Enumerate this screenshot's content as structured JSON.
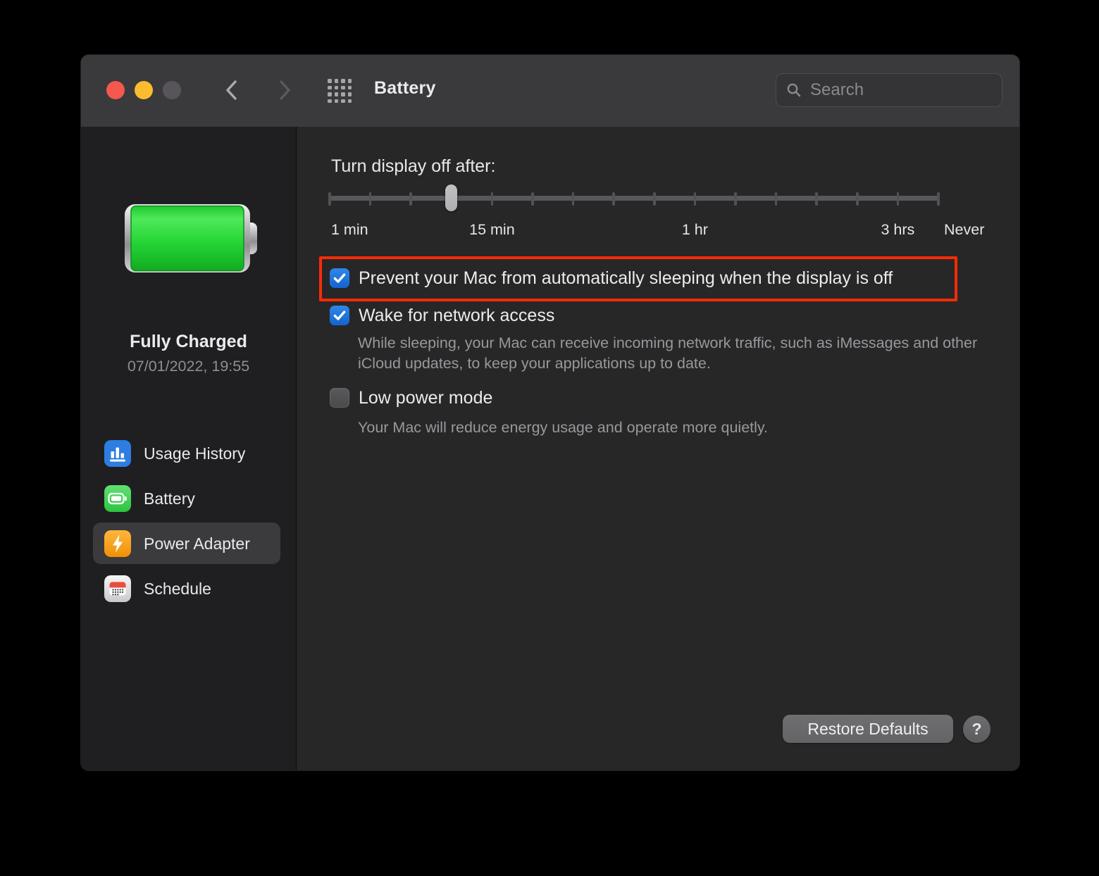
{
  "window": {
    "title": "Battery",
    "search_placeholder": "Search"
  },
  "icons": {
    "traffic_lights": [
      "close",
      "minimize",
      "fullscreen-disabled"
    ],
    "navigation": [
      "chevron-back",
      "chevron-forward"
    ],
    "toolbar": [
      "show-all-grid",
      "magnifier"
    ],
    "sidebar_items": [
      "bar-chart",
      "battery",
      "lightning-bolt",
      "calendar"
    ],
    "battery_graphic": "full-green-battery",
    "help": "question-mark"
  },
  "colors": {
    "titlebar": "#3a3a3c",
    "sidebar_bg": "#1f1f21",
    "content_bg": "#272728",
    "accent_blue": "#1b6fd6",
    "highlight_red": "#f92b05",
    "battery_green": "#2ed13c",
    "unchecked_gray": "#545456"
  },
  "sidebar": {
    "status": {
      "title": "Fully Charged",
      "timestamp": "07/01/2022, 19:55"
    },
    "items": [
      {
        "label": "Usage History",
        "icon": "bar-chart",
        "selected": false
      },
      {
        "label": "Battery",
        "icon": "battery",
        "selected": false
      },
      {
        "label": "Power Adapter",
        "icon": "lightning-bolt",
        "selected": true
      },
      {
        "label": "Schedule",
        "icon": "calendar",
        "selected": false
      }
    ]
  },
  "main": {
    "slider": {
      "label": "Turn display off after:",
      "tick_count": 16,
      "thumb_tick_index": 3,
      "tick_labels": [
        {
          "text": "1 min",
          "tick": 0,
          "align": "start"
        },
        {
          "text": "15 min",
          "tick": 4,
          "align": "center"
        },
        {
          "text": "1 hr",
          "tick": 9,
          "align": "center"
        },
        {
          "text": "3 hrs",
          "tick": 14,
          "align": "center"
        },
        {
          "text": "Never",
          "tick": 15,
          "align": "after-end"
        }
      ]
    },
    "checkboxes": [
      {
        "label": "Prevent your Mac from automatically sleeping when the display is off",
        "checked": true,
        "highlighted": true,
        "description": ""
      },
      {
        "label": "Wake for network access",
        "checked": true,
        "highlighted": false,
        "description": "While sleeping, your Mac can receive incoming network traffic, such as iMessages and other iCloud updates, to keep your applications up to date."
      },
      {
        "label": "Low power mode",
        "checked": false,
        "highlighted": false,
        "description": "Your Mac will reduce energy usage and operate more quietly."
      }
    ],
    "buttons": {
      "restore_defaults": "Restore Defaults",
      "help": "?"
    }
  }
}
